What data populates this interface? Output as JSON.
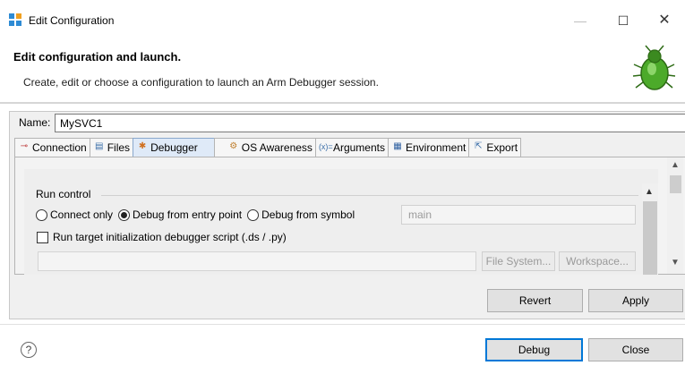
{
  "window": {
    "title": "Edit Configuration",
    "controls": {
      "minimize": "—",
      "maximize": "☐",
      "close": "✕"
    }
  },
  "header": {
    "title": "Edit configuration and launch.",
    "description": "Create, edit or choose a configuration to launch an Arm Debugger session.",
    "image_icon": "bug-icon"
  },
  "name_field": {
    "label": "Name:",
    "value": "MySVC1"
  },
  "tabs": [
    {
      "label": "Connection",
      "icon": "connection-icon"
    },
    {
      "label": "Files",
      "icon": "files-icon"
    },
    {
      "label": "Debugger",
      "icon": "debugger-icon",
      "active": true
    },
    {
      "label": "OS Awareness",
      "icon": "os-awareness-icon"
    },
    {
      "label": "Arguments",
      "icon": "arguments-icon"
    },
    {
      "label": "Environment",
      "icon": "environment-icon"
    },
    {
      "label": "Export",
      "icon": "export-icon"
    }
  ],
  "debugger": {
    "run_control_label": "Run control",
    "radios": [
      {
        "label": "Connect only",
        "checked": false
      },
      {
        "label": "Debug from entry point",
        "checked": true
      },
      {
        "label": "Debug from symbol",
        "checked": false
      }
    ],
    "symbol_value": "main",
    "init_script_label": "Run target initialization debugger script (.ds / .py)",
    "init_script_checked": false,
    "file_system_label": "File System...",
    "workspace_label": "Workspace..."
  },
  "buttons": {
    "revert": "Revert",
    "apply": "Apply",
    "debug": "Debug",
    "close": "Close",
    "help": "?"
  },
  "colors": {
    "accent": "#0078d7",
    "active_tab": "#dfeaf8"
  }
}
